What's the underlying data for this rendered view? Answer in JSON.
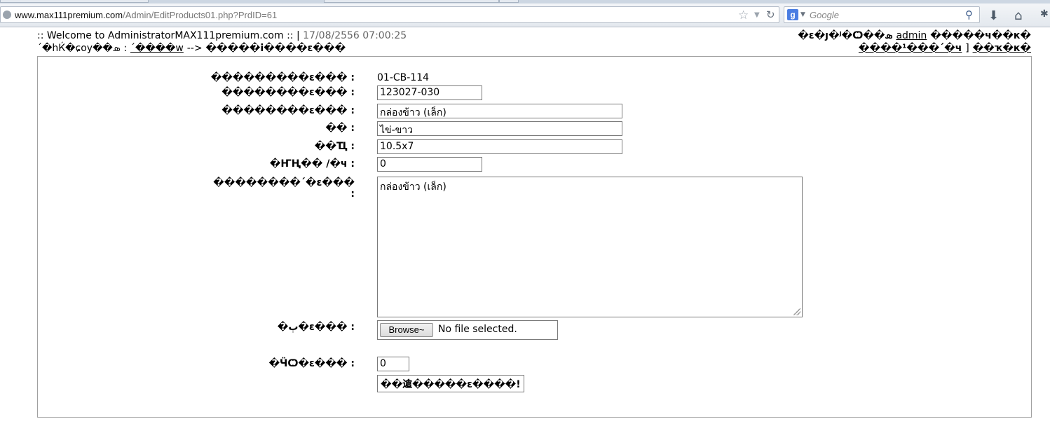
{
  "browser": {
    "url_host": "www.max111premium.com",
    "url_path": "/Admin/EditProducts01.php?PrdID=61",
    "search_placeholder": "Google",
    "search_engine_letter": "g"
  },
  "header": {
    "welcome": ":: Welcome to AdministratorMAX111premium.com :: |",
    "datetime": "17/08/2556 07:00:25",
    "breadcrumb_prefix": "´�hЌ�ɕoy��ܣ :",
    "breadcrumb_link": "´����w",
    "breadcrumb_arrow": "-->",
    "breadcrumb_current": "�����i����ԑ���",
    "user_prefix": "�ԑ�ȷ�ʲ�Ѻ��ܣ",
    "user_link": "admin",
    "user_suffix": "�����ч��к�",
    "logout_link": "����¹���´�ч",
    "sep": "]",
    "home_link": "��ҡ�к�"
  },
  "form": {
    "fields": [
      {
        "label": "���������ԑ��� :",
        "value": "01-CB-114"
      },
      {
        "label": "��������ԑ��� :",
        "value": "123027-030"
      },
      {
        "label": "��������ԑ��� :",
        "value": "กล่องข้าว (เล็ก)"
      },
      {
        "label": "�� :",
        "value": "ไข่-ขาว"
      },
      {
        "label": "��Ҵ :",
        "value": "10.5x7"
      },
      {
        "label": "�ҤҢ�� /�ч :",
        "value": "0"
      }
    ],
    "description_label": "��������´�ԑ���",
    "description_colon": ":",
    "description_value": "กล่องข้าว (เล็ก)",
    "image_label": "�ٻ�ԑ��� :",
    "browse_label": "Browse~",
    "file_status": "No file selected.",
    "order_label": "�ӴѺ�ԑ��� :",
    "order_value": "0",
    "submit_label": "��䢢�����ԑ����!"
  }
}
